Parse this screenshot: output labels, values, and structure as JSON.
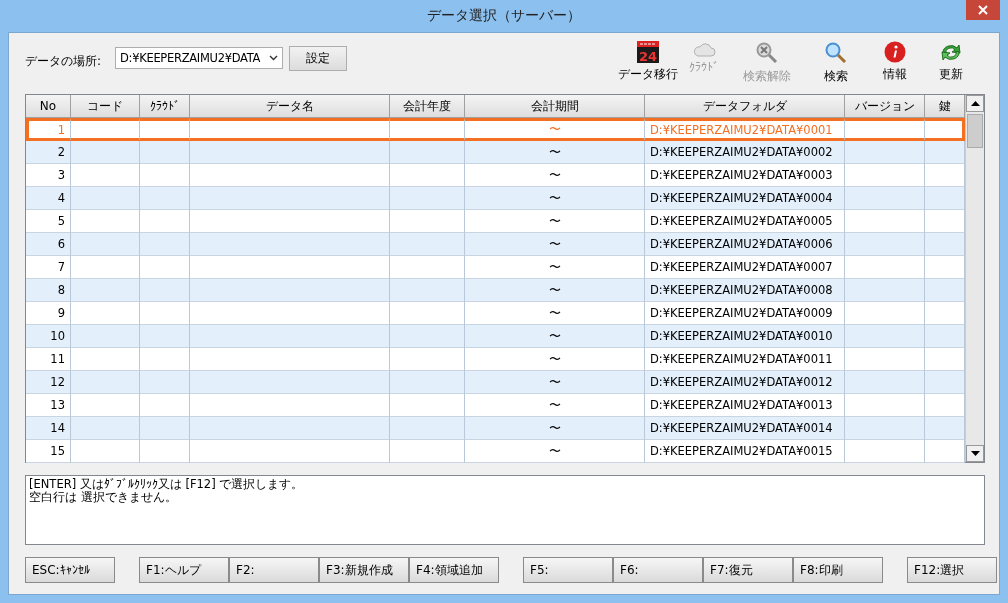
{
  "window": {
    "title": "データ選択（サーバー）"
  },
  "location": {
    "label": "データの場所:",
    "value": "D:¥KEEPERZAIMU2¥DATA",
    "button": "設定"
  },
  "toolbar": [
    {
      "kind": "logo",
      "label": "データ移行",
      "logo_number": "24",
      "disabled": false
    },
    {
      "kind": "cloud",
      "label": "ｸﾗｳﾄﾞ",
      "disabled": true
    },
    {
      "kind": "search-clear",
      "label": "検索解除",
      "disabled": true
    },
    {
      "kind": "search",
      "label": "検索",
      "disabled": false
    },
    {
      "kind": "info",
      "label": "情報",
      "disabled": false
    },
    {
      "kind": "refresh",
      "label": "更新",
      "disabled": false
    }
  ],
  "table": {
    "columns": [
      "No",
      "コード",
      "ｸﾗｳﾄﾞ",
      "データ名",
      "会計年度",
      "会計期間",
      "データフォルダ",
      "バージョン",
      "鍵"
    ],
    "rows": [
      {
        "no": "1",
        "period": "〜",
        "folder": "D:¥KEEPERZAIMU2¥DATA¥0001",
        "selected": true
      },
      {
        "no": "2",
        "period": "〜",
        "folder": "D:¥KEEPERZAIMU2¥DATA¥0002",
        "selected": false
      },
      {
        "no": "3",
        "period": "〜",
        "folder": "D:¥KEEPERZAIMU2¥DATA¥0003",
        "selected": false
      },
      {
        "no": "4",
        "period": "〜",
        "folder": "D:¥KEEPERZAIMU2¥DATA¥0004",
        "selected": false
      },
      {
        "no": "5",
        "period": "〜",
        "folder": "D:¥KEEPERZAIMU2¥DATA¥0005",
        "selected": false
      },
      {
        "no": "6",
        "period": "〜",
        "folder": "D:¥KEEPERZAIMU2¥DATA¥0006",
        "selected": false
      },
      {
        "no": "7",
        "period": "〜",
        "folder": "D:¥KEEPERZAIMU2¥DATA¥0007",
        "selected": false
      },
      {
        "no": "8",
        "period": "〜",
        "folder": "D:¥KEEPERZAIMU2¥DATA¥0008",
        "selected": false
      },
      {
        "no": "9",
        "period": "〜",
        "folder": "D:¥KEEPERZAIMU2¥DATA¥0009",
        "selected": false
      },
      {
        "no": "10",
        "period": "〜",
        "folder": "D:¥KEEPERZAIMU2¥DATA¥0010",
        "selected": false
      },
      {
        "no": "11",
        "period": "〜",
        "folder": "D:¥KEEPERZAIMU2¥DATA¥0011",
        "selected": false
      },
      {
        "no": "12",
        "period": "〜",
        "folder": "D:¥KEEPERZAIMU2¥DATA¥0012",
        "selected": false
      },
      {
        "no": "13",
        "period": "〜",
        "folder": "D:¥KEEPERZAIMU2¥DATA¥0013",
        "selected": false
      },
      {
        "no": "14",
        "period": "〜",
        "folder": "D:¥KEEPERZAIMU2¥DATA¥0014",
        "selected": false
      },
      {
        "no": "15",
        "period": "〜",
        "folder": "D:¥KEEPERZAIMU2¥DATA¥0015",
        "selected": false
      }
    ]
  },
  "message": [
    "[ENTER] 又はﾀﾞﾌﾞﾙｸﾘｯｸ又は [F12] で選択します。",
    "空白行は 選択できません。"
  ],
  "function_keys": [
    [
      "ESC:ｷｬﾝｾﾙ"
    ],
    [
      "F1:ヘルプ",
      "F2:",
      "F3:新規作成",
      "F4:領域追加"
    ],
    [
      "F5:",
      "F6:",
      "F7:復元",
      "F8:印刷"
    ],
    [
      "F12:選択"
    ]
  ]
}
